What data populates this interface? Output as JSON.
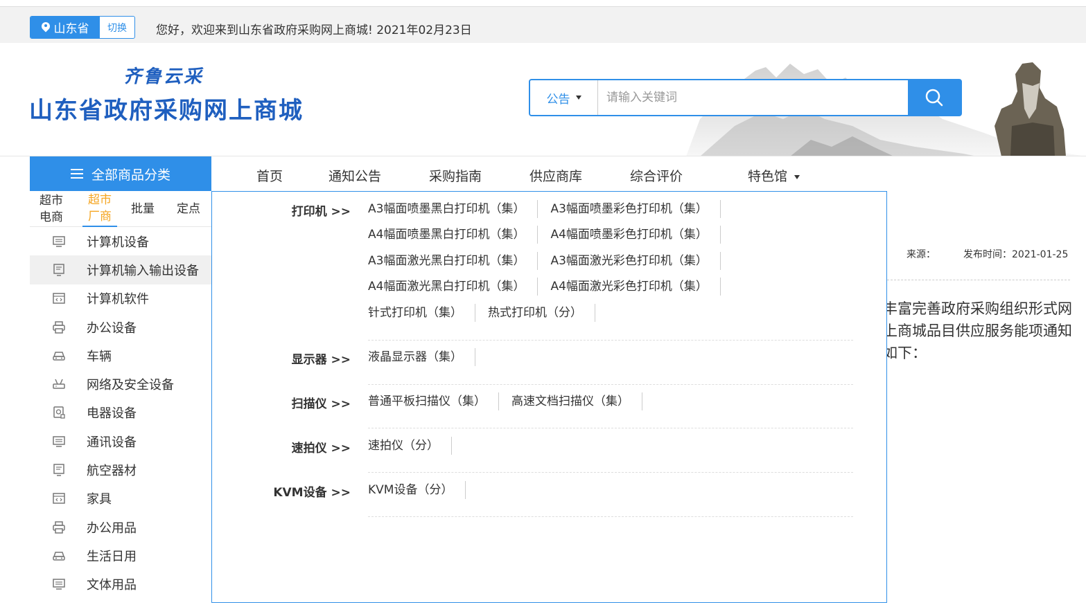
{
  "topbar": {
    "province": "山东省",
    "switch_label": "切换",
    "welcome": "您好，欢迎来到山东省政府采购网上商城!  2021年02月23日"
  },
  "header": {
    "logo_sub": "齐鲁云采",
    "logo_main": "山东省政府采购网上商城"
  },
  "search": {
    "category": "公告",
    "placeholder": "请输入关键词"
  },
  "nav": {
    "all_categories": "全部商品分类",
    "items": [
      "首页",
      "通知公告",
      "采购指南",
      "供应商库",
      "综合评价",
      "特色馆"
    ]
  },
  "sidebar": {
    "tabs": [
      "超市\n电商",
      "超市\n厂商",
      "批量",
      "定点"
    ],
    "active_tab": 1,
    "categories": [
      {
        "label": "计算机设备",
        "icon": "monitor-icon"
      },
      {
        "label": "计算机输入输出设备",
        "icon": "io-device-icon"
      },
      {
        "label": "计算机软件",
        "icon": "software-icon"
      },
      {
        "label": "办公设备",
        "icon": "printer-icon"
      },
      {
        "label": "车辆",
        "icon": "car-icon"
      },
      {
        "label": "网络及安全设备",
        "icon": "router-icon"
      },
      {
        "label": "电器设备",
        "icon": "appliance-icon"
      },
      {
        "label": "通讯设备",
        "icon": "monitor-icon"
      },
      {
        "label": "航空器材",
        "icon": "io-device-icon"
      },
      {
        "label": "家具",
        "icon": "software-icon"
      },
      {
        "label": "办公用品",
        "icon": "printer-icon"
      },
      {
        "label": "生活日用",
        "icon": "car-icon"
      },
      {
        "label": "文体用品",
        "icon": "monitor-icon"
      }
    ]
  },
  "dropdown": {
    "groups": [
      {
        "title": "打印机 >>",
        "rows": [
          [
            "A3幅面喷墨黑白打印机（集）",
            "A3幅面喷墨彩色打印机（集）"
          ],
          [
            "A4幅面喷墨黑白打印机（集）",
            "A4幅面喷墨彩色打印机（集）"
          ],
          [
            "A3幅面激光黑白打印机（集）",
            "A3幅面激光彩色打印机（集）"
          ],
          [
            "A4幅面激光黑白打印机（集）",
            "A4幅面激光彩色打印机（集）"
          ],
          [
            "针式打印机（集）",
            "热式打印机（分）"
          ]
        ]
      },
      {
        "title": "显示器 >>",
        "rows": [
          [
            "液晶显示器（集）"
          ]
        ]
      },
      {
        "title": "扫描仪 >>",
        "rows": [
          [
            "普通平板扫描仪（集）",
            "高速文档扫描仪（集）"
          ]
        ]
      },
      {
        "title": "速拍仪 >>",
        "rows": [
          [
            "速拍仪（分）"
          ]
        ]
      },
      {
        "title": "KVM设备 >>",
        "rows": [
          [
            "KVM设备（分）"
          ]
        ]
      }
    ]
  },
  "article": {
    "source_label": "来源：",
    "publish_time": "发布时间：2021-01-25",
    "paragraph": "丰富完善政府采购组织形式网上商城品目供应服务能项通知如下："
  },
  "colors": {
    "accent": "#2f8fe8",
    "active_tab": "#f5a623"
  }
}
